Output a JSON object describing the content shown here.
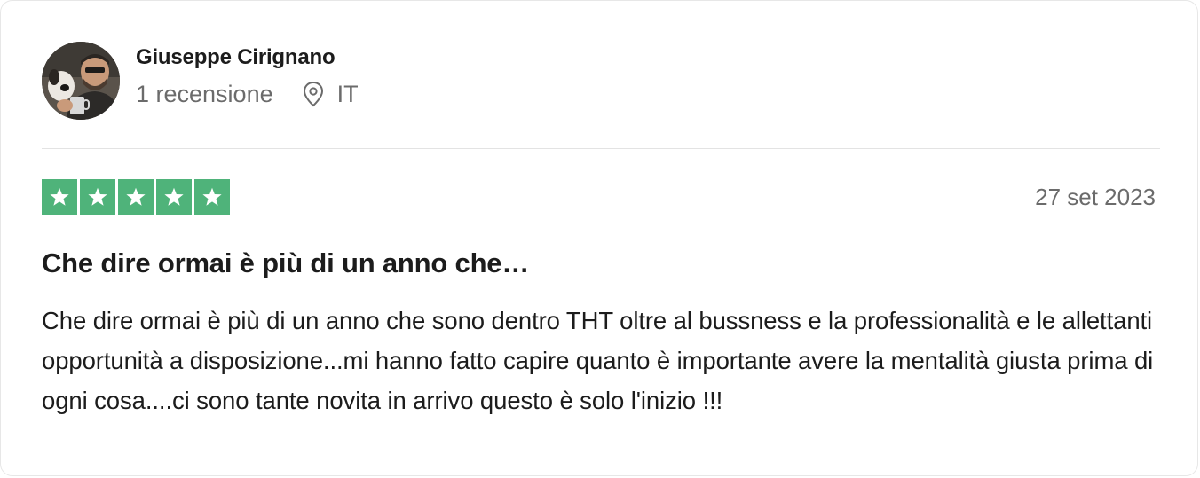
{
  "consumer": {
    "name": "Giuseppe Cirignano",
    "reviews_count": "1 recensione",
    "country": "IT",
    "location_icon": "pin-icon",
    "avatar_icon": "user-avatar"
  },
  "review": {
    "rating": 5,
    "rating_max": 5,
    "star_color": "#4fb37a",
    "date": "27 set 2023",
    "title": "Che dire ormai è più di un anno che…",
    "text": "Che dire ormai è più di un anno che sono dentro THT oltre al bussness e la professionalità e le allettanti opportunità a disposizione...mi hanno fatto capire quanto è importante avere la mentalità giusta prima di ogni cosa....ci sono tante novita in arrivo questo è solo l'inizio !!!"
  }
}
